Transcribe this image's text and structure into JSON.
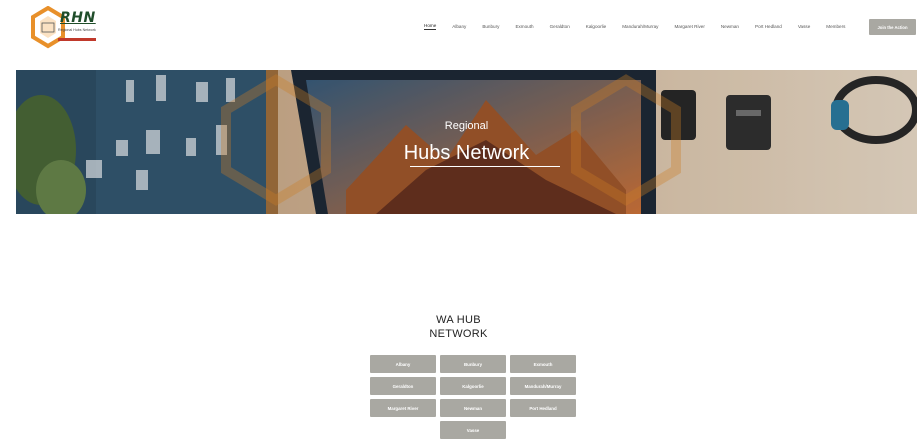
{
  "header": {
    "logo_text": "RHN",
    "logo_subtext": "Regional Hubs Network",
    "nav": [
      {
        "label": "Home",
        "active": true
      },
      {
        "label": "Albany"
      },
      {
        "label": "Bunbury"
      },
      {
        "label": "Exmouth"
      },
      {
        "label": "Geraldton"
      },
      {
        "label": "Kalgoorlie"
      },
      {
        "label": "Mandurah/Murray"
      },
      {
        "label": "Margaret River"
      },
      {
        "label": "Newman"
      },
      {
        "label": "Port Hedland"
      },
      {
        "label": "Vasse"
      },
      {
        "label": "Members"
      }
    ],
    "cta_label": "Join the Action"
  },
  "hero": {
    "line1": "Regional",
    "line2": "Hubs Network"
  },
  "section": {
    "title_line1": "WA HUB",
    "title_line2": "NETWORK",
    "hubs": [
      "Albany",
      "Bunbury",
      "Exmouth",
      "Geraldton",
      "Kalgoorlie",
      "Mandurah/Murray",
      "Margaret River",
      "Newman",
      "Port Hedland",
      "Vasse"
    ]
  },
  "colors": {
    "button_gray": "#a9a8a2",
    "logo_orange": "#e8902a",
    "logo_green": "#1f4d2a"
  }
}
